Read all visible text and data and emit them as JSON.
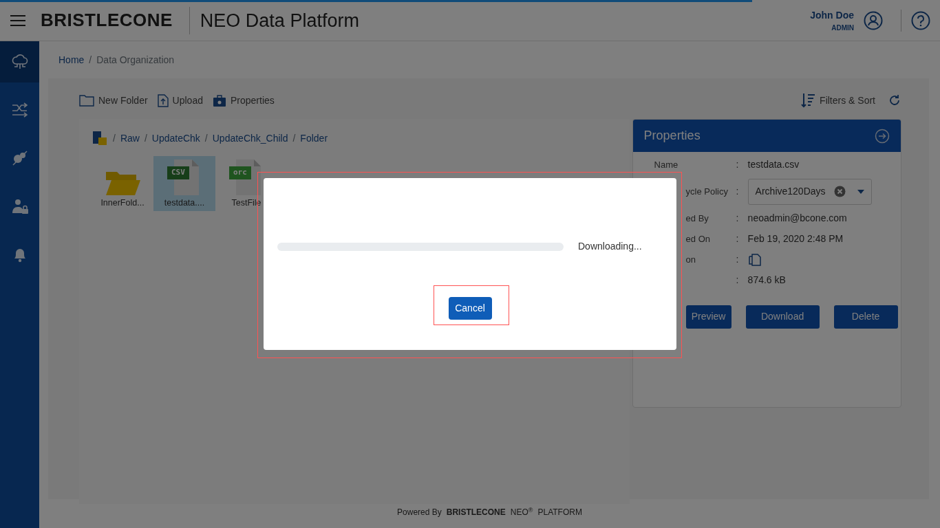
{
  "header": {
    "loading": {
      "level": 0.8
    },
    "brand": "BRISTLECONE",
    "app_title": "NEO Data Platform",
    "user": {
      "name": "John Doe",
      "role": "ADMIN"
    }
  },
  "sidebar": {
    "items": [
      {
        "kind": "cloud",
        "selected": true
      },
      {
        "kind": "flow",
        "selected": false
      },
      {
        "kind": "gears",
        "selected": false
      },
      {
        "kind": "user-lock",
        "selected": false
      },
      {
        "kind": "bell",
        "selected": false
      }
    ]
  },
  "breadcrumb": [
    {
      "label": "Home",
      "link": true
    },
    {
      "separator": "/",
      "label": "Data Organization",
      "link": false
    }
  ],
  "toolbar": {
    "actions": [
      {
        "label": "New Folder",
        "kind": "folder"
      },
      {
        "label": "Upload",
        "kind": "upload"
      },
      {
        "label": "Properties",
        "kind": "briefcase"
      }
    ],
    "filters": "Filters & Sort"
  },
  "path": [
    {
      "separator": "/",
      "label": "Raw"
    },
    {
      "separator": "/",
      "label": "UpdateChk"
    },
    {
      "separator": "/",
      "label": "UpdateChk_Child"
    },
    {
      "separator": "/",
      "label": "Folder"
    }
  ],
  "files": [
    {
      "name": "InnerFold...",
      "kind": "folder",
      "selected": false
    },
    {
      "name": "testdata....",
      "kind": "csv",
      "tag": "CSV",
      "selected": true
    },
    {
      "name": "TestFile",
      "kind": "orc",
      "tag": "orc",
      "selected": false
    }
  ],
  "properties": {
    "title": "Properties",
    "rows": [
      {
        "label": "Name",
        "label_cut": false,
        "colon": ":",
        "kind": "text",
        "value": "testdata.csv"
      },
      {
        "label": "ycle Policy",
        "label_cut": true,
        "colon": ":",
        "kind": "select",
        "value": "Archive120Days"
      },
      {
        "label": "ed By",
        "label_cut": true,
        "colon": ":",
        "kind": "text",
        "value": "neoadmin@bcone.com"
      },
      {
        "label": "ed On",
        "label_cut": true,
        "colon": ":",
        "kind": "text",
        "value": "Feb 19, 2020 2:48 PM"
      },
      {
        "label": "on",
        "label_cut": true,
        "colon": ":",
        "kind": "icon"
      },
      {
        "colon": ":",
        "kind": "text",
        "value": "874.6 kB"
      }
    ],
    "buttons": [
      "Preview",
      "Download",
      "Delete"
    ]
  },
  "modal": {
    "progress": {
      "level": 0
    },
    "status": "Downloading...",
    "button": "Cancel"
  },
  "footer": {
    "powered": "Powered By",
    "brand": "BRISTLECONE",
    "product": "NEO$^{®}$",
    "suffix": "PLATFORM"
  }
}
